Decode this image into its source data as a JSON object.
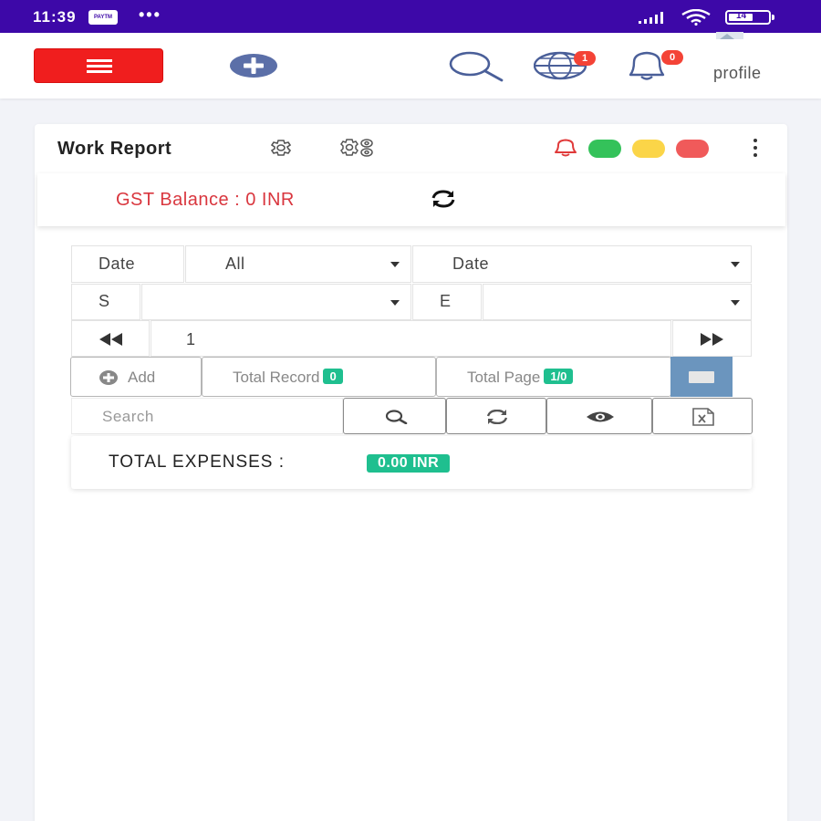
{
  "status_bar": {
    "time": "11:39",
    "badge": "PAYTM",
    "dots": "•••",
    "battery_level": "14"
  },
  "top_bar": {
    "globe_badge": "1",
    "bell_badge": "0",
    "profile_label": "profile"
  },
  "card": {
    "title": "Work Report",
    "gst_balance": "GST Balance : 0 INR"
  },
  "filters": {
    "date_label": "Date",
    "date_filter_value": "All",
    "date_select_value": "Date",
    "start_label": "S",
    "start_value": "",
    "end_label": "E",
    "end_value": "",
    "page_number": "1"
  },
  "toolbar": {
    "add_label": "Add",
    "total_record_label": "Total Record",
    "total_record_count": "0",
    "total_page_label": "Total Page",
    "total_page_count": "1/0",
    "search_placeholder": "Search"
  },
  "totals": {
    "label": "TOTAL EXPENSES :",
    "value": "0.00 INR"
  },
  "colors": {
    "status_bar": "#3d08a8",
    "menu_button": "#f01e1e",
    "gst_text": "#d9363e",
    "pill": "#1fbf8f",
    "dot_green": "#34c25a",
    "dot_yellow": "#fbd548",
    "dot_red": "#f05a5a"
  },
  "icons": [
    "menu-icon",
    "add-circle-icon",
    "search-icon",
    "globe-icon",
    "bell-icon",
    "settings-gear-icon",
    "settings-gears-icon",
    "refresh-icon",
    "first-page-icon",
    "last-page-icon",
    "plus-circle-icon",
    "eye-icon",
    "excel-export-icon",
    "more-vert-icon"
  ]
}
